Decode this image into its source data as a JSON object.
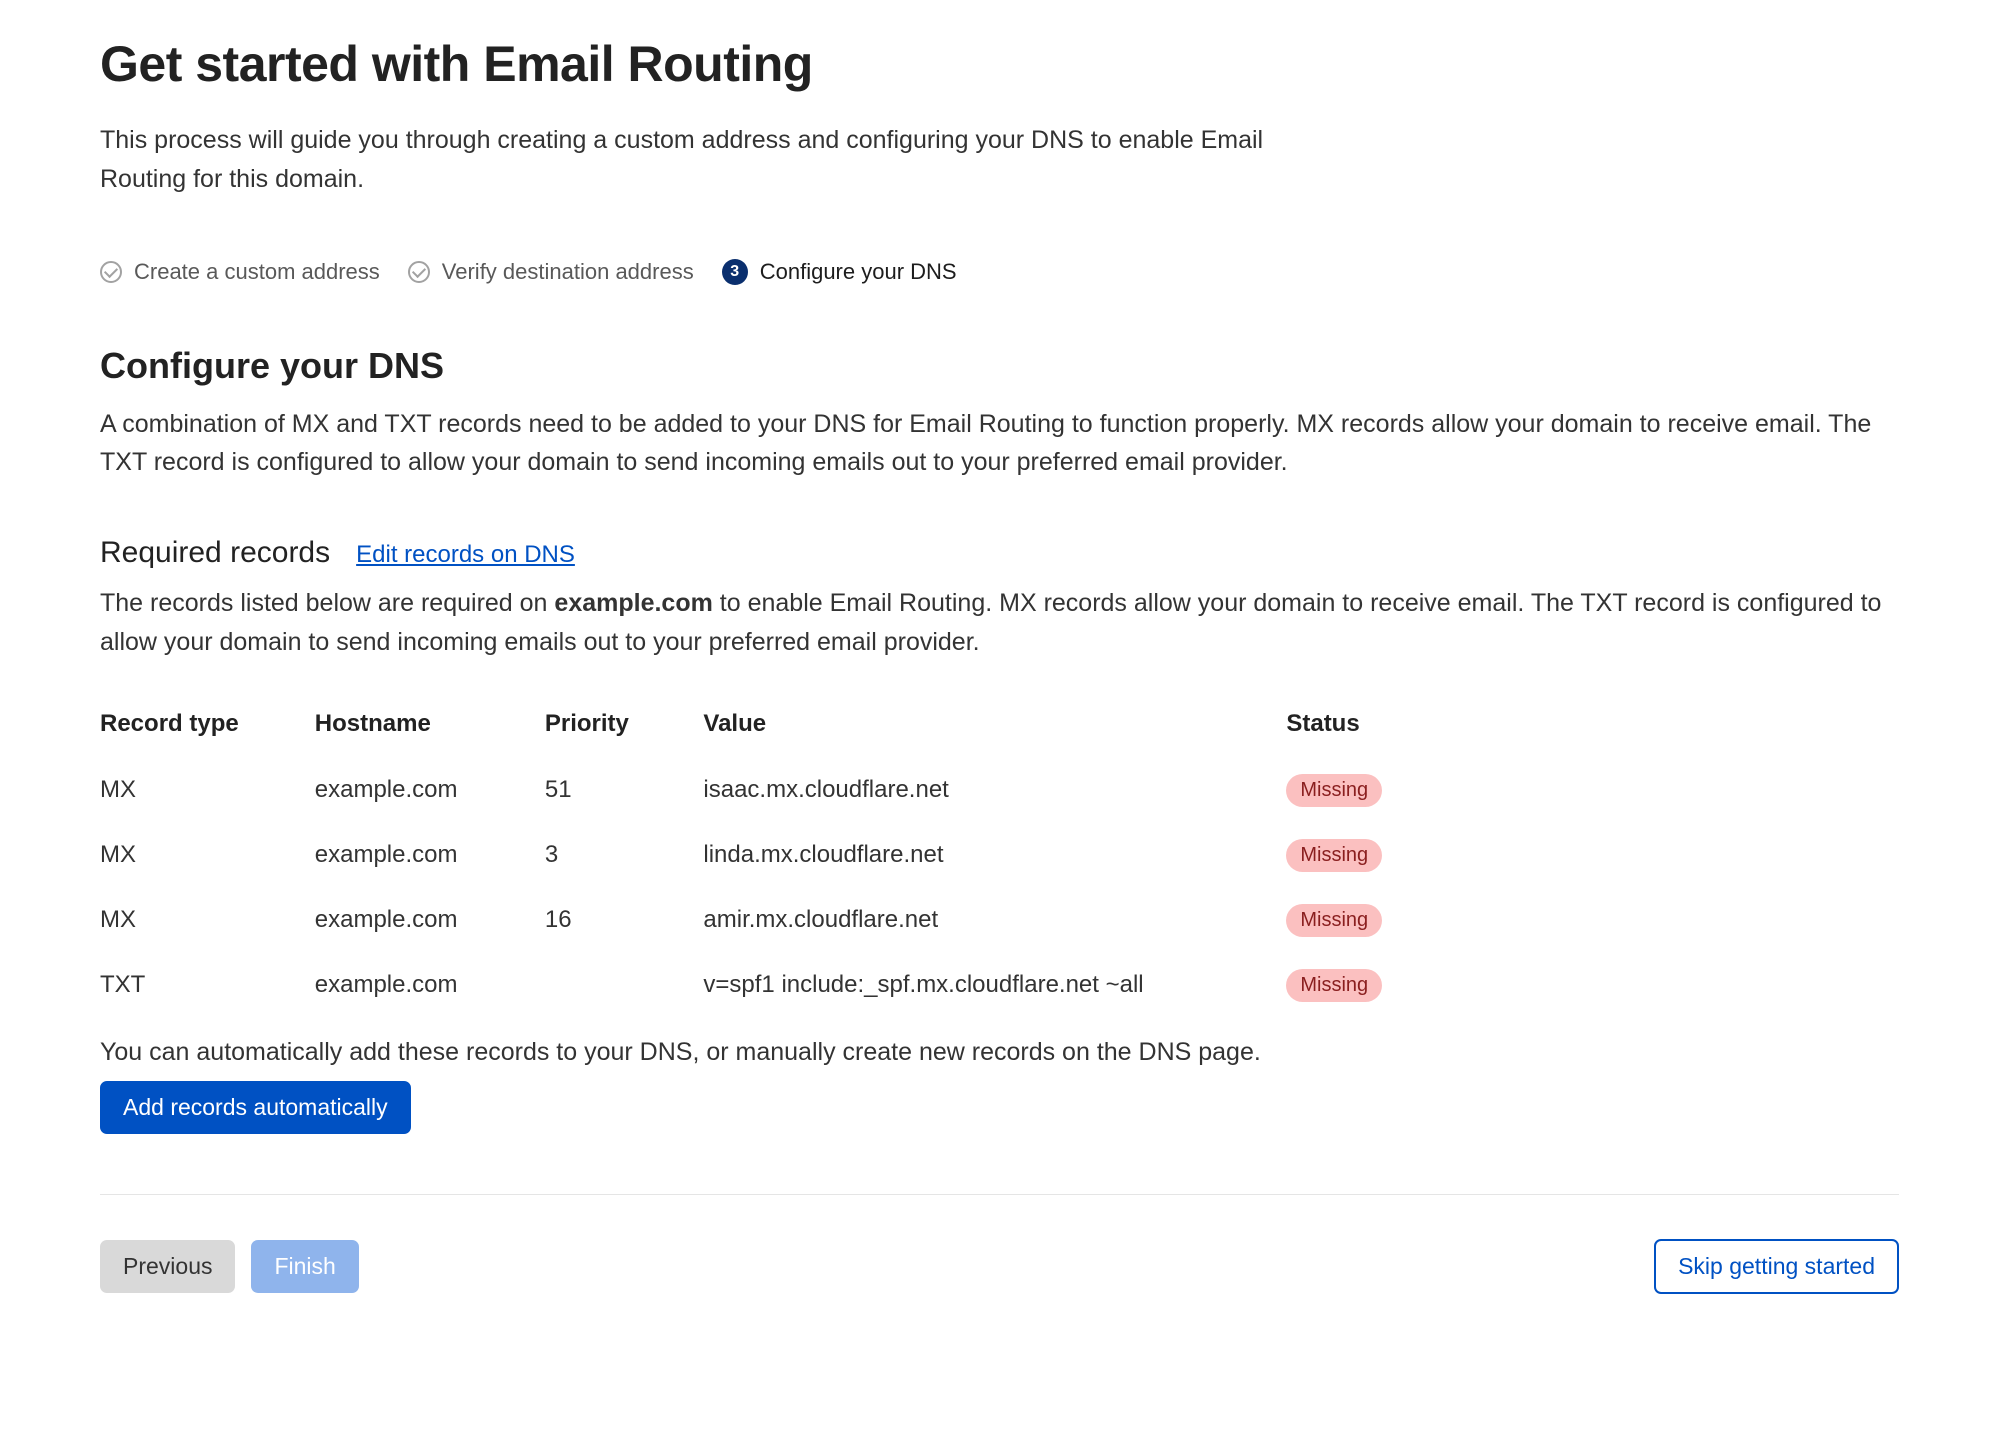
{
  "header": {
    "title": "Get started with Email Routing",
    "intro": "This process will guide you through creating a custom address and configuring your DNS to enable Email Routing for this domain."
  },
  "steps": [
    {
      "label": "Create a custom address",
      "state": "done"
    },
    {
      "label": "Verify destination address",
      "state": "done"
    },
    {
      "label": "Configure your DNS",
      "state": "active",
      "number": "3"
    }
  ],
  "configure": {
    "title": "Configure your DNS",
    "desc": "A combination of MX and TXT records need to be added to your DNS for Email Routing to function properly. MX records allow your domain to receive email. The TXT record is configured to allow your domain to send incoming emails out to your preferred email provider."
  },
  "required": {
    "subhead": "Required records",
    "edit_link": "Edit records on DNS",
    "desc_prefix": "The records listed below are required on ",
    "domain": "example.com",
    "desc_suffix": " to enable Email Routing. MX records allow your domain to receive email. The TXT record is configured to allow your domain to send incoming emails out to your preferred email provider."
  },
  "table": {
    "headers": {
      "type": "Record type",
      "hostname": "Hostname",
      "priority": "Priority",
      "value": "Value",
      "status": "Status"
    },
    "rows": [
      {
        "type": "MX",
        "hostname": "example.com",
        "priority": "51",
        "value": "isaac.mx.cloudflare.net",
        "status": "Missing"
      },
      {
        "type": "MX",
        "hostname": "example.com",
        "priority": "3",
        "value": "linda.mx.cloudflare.net",
        "status": "Missing"
      },
      {
        "type": "MX",
        "hostname": "example.com",
        "priority": "16",
        "value": "amir.mx.cloudflare.net",
        "status": "Missing"
      },
      {
        "type": "TXT",
        "hostname": "example.com",
        "priority": "",
        "value": "v=spf1 include:_spf.mx.cloudflare.net ~all",
        "status": "Missing"
      }
    ]
  },
  "auto": {
    "note": "You can automatically add these records to your DNS, or manually create new records on the DNS page.",
    "button": "Add records automatically"
  },
  "footer": {
    "previous": "Previous",
    "finish": "Finish",
    "skip": "Skip getting started"
  }
}
